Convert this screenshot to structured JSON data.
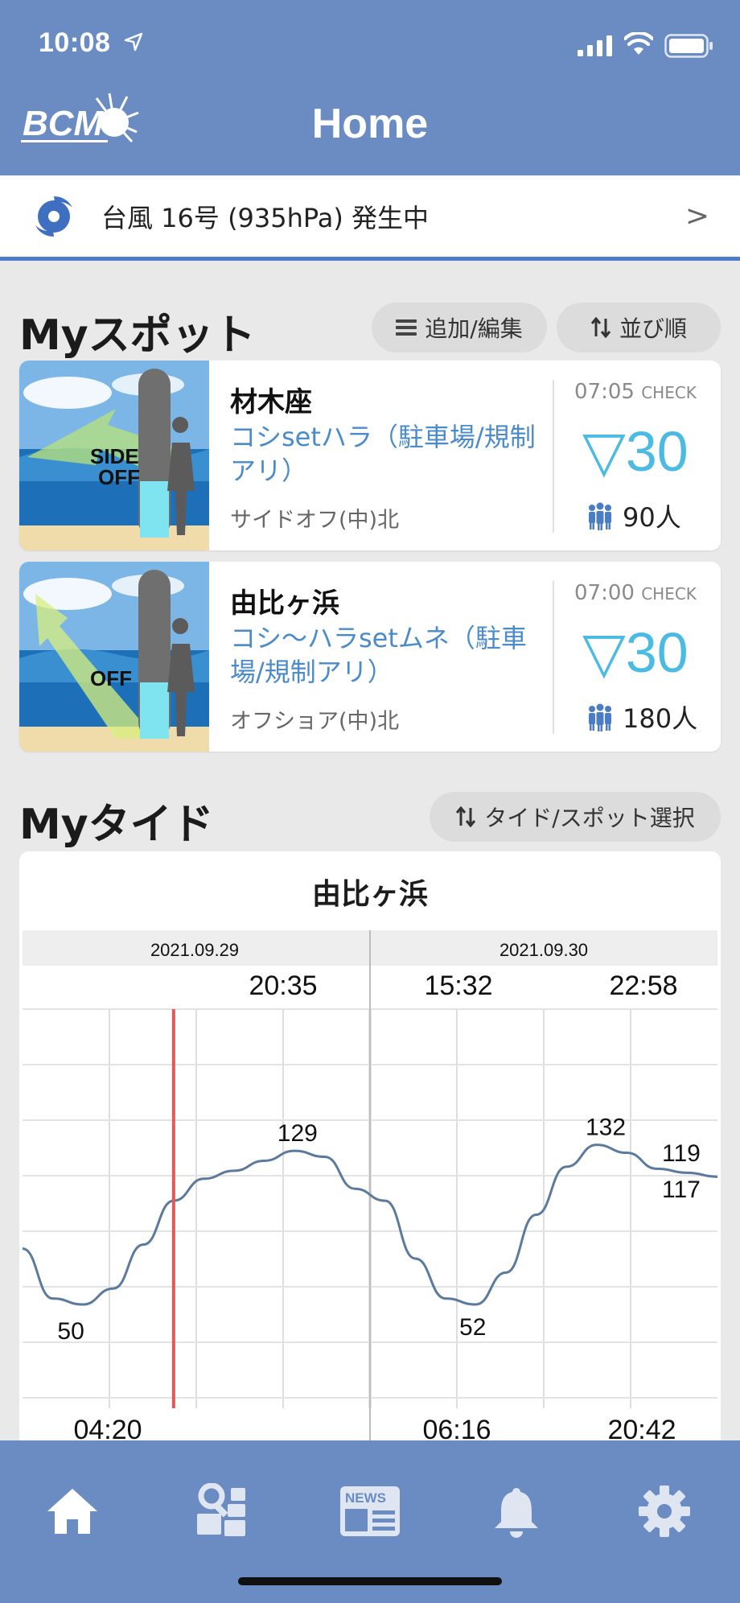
{
  "status": {
    "time": "10:08"
  },
  "header": {
    "title": "Home",
    "logo_text": "BCM"
  },
  "alert": {
    "text": "台風 16号 (935hPa) 発生中",
    "chevron": ">"
  },
  "myspot": {
    "title": "Myスポット",
    "add_edit_label": "追加/編集",
    "sort_label": "並び順",
    "spots": [
      {
        "name": "材木座",
        "condition": "コシsetハラ（駐車場/規制アリ）",
        "wind": "サイドオフ(中)北",
        "check_time": "07:05",
        "check_label": "CHECK",
        "wave": "30",
        "people": "90人",
        "thumb_label_1": "SIDE",
        "thumb_label_2": "OFF"
      },
      {
        "name": "由比ヶ浜",
        "condition": "コシ〜ハラsetムネ（駐車場/規制アリ）",
        "wind": "オフショア(中)北",
        "check_time": "07:00",
        "check_label": "CHECK",
        "wave": "30",
        "people": "180人",
        "thumb_label_1": "",
        "thumb_label_2": "OFF"
      }
    ]
  },
  "mytide": {
    "title": "Myタイド",
    "select_label": "タイド/スポット選択",
    "spot_name": "由比ヶ浜"
  },
  "chart_data": {
    "type": "line",
    "dates": [
      "2021.09.29",
      "2021.09.30"
    ],
    "high_tide_times": [
      "20:35",
      "15:32",
      "22:58"
    ],
    "low_tide_times": [
      "04:20",
      "06:16",
      "20:42"
    ],
    "extremes": [
      {
        "label": "50",
        "x": 1.6,
        "y": 50
      },
      {
        "label": "129",
        "x": 9.1,
        "y": 129
      },
      {
        "label": "52",
        "x": 14.9,
        "y": 52
      },
      {
        "label": "132",
        "x": 19.3,
        "y": 132
      },
      {
        "label": "119",
        "x": 21.8,
        "y": 119
      },
      {
        "label": "117",
        "x": 21.8,
        "y": 117
      }
    ],
    "series": [
      {
        "values": [
          [
            0,
            80
          ],
          [
            1,
            55
          ],
          [
            2,
            52
          ],
          [
            3,
            60
          ],
          [
            4,
            82
          ],
          [
            5,
            104
          ],
          [
            6,
            115
          ],
          [
            7,
            119
          ],
          [
            8,
            124
          ],
          [
            9,
            129
          ],
          [
            10,
            126
          ],
          [
            11,
            110
          ],
          [
            12,
            104
          ],
          [
            13,
            75
          ],
          [
            14,
            55
          ],
          [
            15,
            52
          ],
          [
            16,
            68
          ],
          [
            17,
            97
          ],
          [
            18,
            121
          ],
          [
            19,
            132
          ],
          [
            20,
            128
          ],
          [
            21,
            120
          ],
          [
            22,
            118
          ],
          [
            23,
            116
          ]
        ]
      }
    ],
    "current_time_x": 5,
    "ylim": [
      0,
      200
    ],
    "grid": true,
    "colors": {
      "line": "#5b7a9d",
      "now": "#e05a5a"
    }
  },
  "nav": {
    "items": [
      "home",
      "surf-spot",
      "news",
      "bell",
      "settings"
    ],
    "news_label": "NEWS"
  },
  "colors": {
    "header": "#6a8cc3",
    "accent": "#4a8bcb",
    "wave": "#4bbbe3"
  }
}
